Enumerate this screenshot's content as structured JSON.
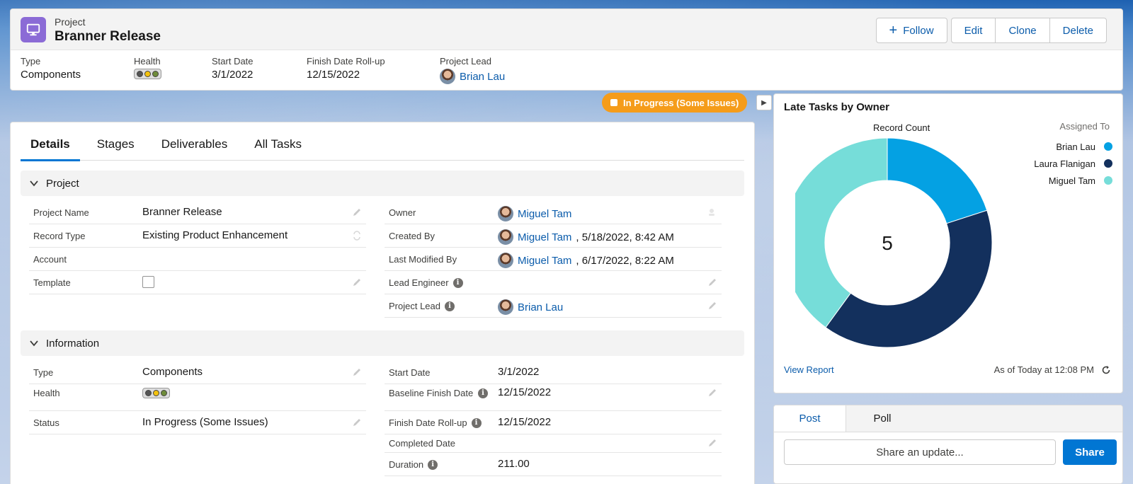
{
  "header": {
    "object_label": "Project",
    "record_title": "Branner Release",
    "buttons": {
      "follow": "Follow",
      "edit": "Edit",
      "clone": "Clone",
      "delete": "Delete"
    },
    "highlights": [
      {
        "label": "Type",
        "value": "Components"
      },
      {
        "label": "Health",
        "value": ""
      },
      {
        "label": "Start Date",
        "value": "3/1/2022"
      },
      {
        "label": "Finish Date Roll-up",
        "value": "12/15/2022"
      },
      {
        "label": "Project Lead",
        "value": "Brian Lau"
      }
    ]
  },
  "status_pill": "In Progress (Some Issues)",
  "tabs": [
    "Details",
    "Stages",
    "Deliverables",
    "All Tasks"
  ],
  "sections": {
    "project": {
      "title": "Project",
      "left": [
        {
          "label": "Project Name",
          "value": "Branner Release"
        },
        {
          "label": "Record Type",
          "value": "Existing Product Enhancement"
        },
        {
          "label": "Account",
          "value": ""
        },
        {
          "label": "Template",
          "value": ""
        }
      ],
      "right": [
        {
          "label": "Owner",
          "value": "Miguel Tam",
          "suffix": ""
        },
        {
          "label": "Created By",
          "value": "Miguel Tam",
          "suffix": ", 5/18/2022, 8:42 AM"
        },
        {
          "label": "Last Modified By",
          "value": "Miguel Tam",
          "suffix": ", 6/17/2022, 8:22 AM"
        },
        {
          "label": "Lead Engineer",
          "value": "",
          "suffix": ""
        },
        {
          "label": "Project Lead",
          "value": "Brian Lau",
          "suffix": ""
        }
      ]
    },
    "information": {
      "title": "Information",
      "left": [
        {
          "label": "Type",
          "value": "Components"
        },
        {
          "label": "Health",
          "value": ""
        },
        {
          "label": "Status",
          "value": "In Progress (Some Issues)"
        }
      ],
      "right": [
        {
          "label": "Start Date",
          "value": "3/1/2022"
        },
        {
          "label": "Baseline Finish Date",
          "value": "12/15/2022"
        },
        {
          "label": "Finish Date Roll-up",
          "value": "12/15/2022"
        },
        {
          "label": "Completed Date",
          "value": ""
        },
        {
          "label": "Duration",
          "value": "211.00"
        }
      ]
    }
  },
  "chart_card": {
    "title": "Late Tasks by Owner",
    "view_report": "View Report",
    "as_of": "As of Today at 12:08 PM"
  },
  "chart_data": {
    "type": "pie",
    "title": "Late Tasks by Owner",
    "subtitle": "Record Count",
    "legend_title": "Assigned To",
    "legend_position": "right",
    "center_total": "5",
    "categories": [
      "Brian Lau",
      "Laura Flanigan",
      "Miguel Tam"
    ],
    "values": [
      1,
      2,
      2
    ],
    "colors": [
      "#04a1e3",
      "#13305d",
      "#76ddd9"
    ]
  },
  "publisher": {
    "tabs": [
      "Post",
      "Poll"
    ],
    "placeholder": "Share an update...",
    "share": "Share"
  }
}
